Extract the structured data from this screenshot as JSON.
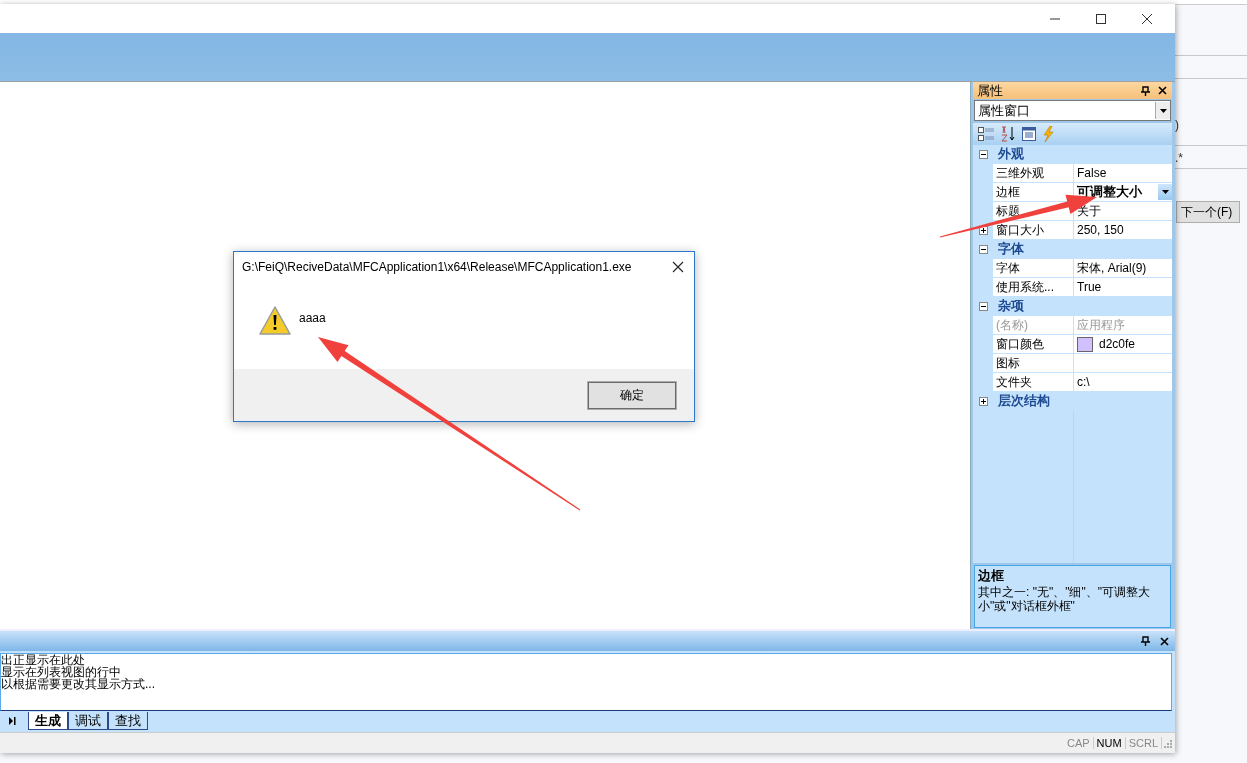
{
  "background_window": {
    "texts": [
      ")",
      ".*"
    ],
    "button": "下一个(F)"
  },
  "properties_panel": {
    "title": "属性",
    "object_combo": "属性窗口",
    "categories": [
      {
        "name": "外观",
        "expanded": true,
        "properties": [
          {
            "name": "三维外观",
            "value": "False",
            "kind": "text",
            "selected": false,
            "disabled": false
          },
          {
            "name": "边框",
            "value": "可调整大小",
            "kind": "text",
            "selected": true,
            "disabled": false
          },
          {
            "name": "标题",
            "value": "关于",
            "kind": "text",
            "selected": false,
            "disabled": false
          },
          {
            "name": "窗口大小",
            "value": "250, 150",
            "kind": "group",
            "selected": false,
            "disabled": false
          }
        ]
      },
      {
        "name": "字体",
        "expanded": true,
        "properties": [
          {
            "name": "字体",
            "value": "宋体, Arial(9)",
            "kind": "text",
            "selected": false,
            "disabled": false
          },
          {
            "name": "使用系统...",
            "value": "True",
            "kind": "text",
            "selected": false,
            "disabled": false
          }
        ]
      },
      {
        "name": "杂项",
        "expanded": true,
        "properties": [
          {
            "name": "(名称)",
            "value": "应用程序",
            "kind": "text",
            "selected": false,
            "disabled": true
          },
          {
            "name": "窗口颜色",
            "value": "d2c0fe",
            "kind": "color",
            "color": "#d2c0fe",
            "selected": false,
            "disabled": false
          },
          {
            "name": "图标",
            "kind": "text",
            "selected": false,
            "disabled": false
          },
          {
            "name": "文件夹",
            "value": "c:\\",
            "kind": "text",
            "selected": false,
            "disabled": false
          }
        ]
      },
      {
        "name": "层次结构",
        "expanded": false
      }
    ],
    "description": {
      "title": "边框",
      "text": "其中之一: \"无\"、\"细\"、\"可调整大小\"或\"对话框外框\""
    }
  },
  "output_panel": {
    "lines": [
      "出正显示在此处",
      "显示在列表视图的行中",
      "以根据需要更改其显示方式..."
    ],
    "tabs": [
      {
        "label": "生成",
        "selected": true
      },
      {
        "label": "调试",
        "selected": false
      },
      {
        "label": "查找",
        "selected": false
      }
    ]
  },
  "status_bar": {
    "indicators": [
      {
        "label": "CAP",
        "on": false
      },
      {
        "label": "NUM",
        "on": true
      },
      {
        "label": "SCRL",
        "on": false
      }
    ]
  },
  "dialog": {
    "title": "G:\\FeiQ\\ReciveData\\MFCApplication1\\x64\\Release\\MFCApplication1.exe",
    "message": "aaaa",
    "button": "确定"
  }
}
